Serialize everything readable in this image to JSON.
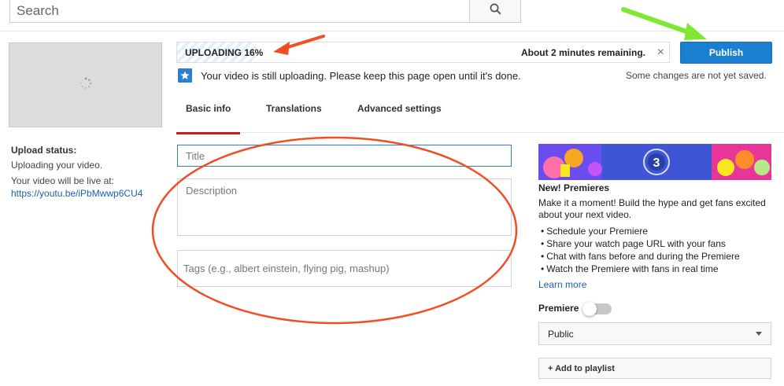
{
  "search": {
    "placeholder": "Search"
  },
  "upload_status": {
    "title": "Upload status:",
    "line1": "Uploading your video.",
    "live_label": "Your video will be live at:",
    "link": "https://youtu.be/iPbMwwp6CU4"
  },
  "progress": {
    "label": "UPLOADING 16%",
    "percent": 16,
    "remaining": "About 2 minutes remaining.",
    "close": "×"
  },
  "publish": {
    "label": "Publish",
    "note": "Some changes are not yet saved."
  },
  "notice": {
    "text": "Your video is still uploading. Please keep this page open until it's done."
  },
  "tabs": [
    {
      "label": "Basic info",
      "active": true
    },
    {
      "label": "Translations",
      "active": false
    },
    {
      "label": "Advanced settings",
      "active": false
    }
  ],
  "fields": {
    "title_placeholder": "Title",
    "description_placeholder": "Description",
    "tags_placeholder": "Tags (e.g., albert einstein, flying pig, mashup)"
  },
  "promo": {
    "banner_number": "3",
    "title": "New! Premieres",
    "desc": "Make it a moment! Build the hype and get fans excited about your next video.",
    "bullets": [
      "Schedule your Premiere",
      "Share your watch page URL with your fans",
      "Chat with fans before and during the Premiere",
      "Watch the Premiere with fans in real time"
    ],
    "learn_more": "Learn more"
  },
  "premiere": {
    "label": "Premiere",
    "enabled": false
  },
  "privacy": {
    "selected": "Public"
  },
  "playlist": {
    "label": "+ Add to playlist"
  },
  "colors": {
    "publish": "#1b7fd1",
    "tab_underline": "#cc181e",
    "link": "#1a5fb4",
    "annotation_orange": "#f04e23",
    "annotation_green": "#7ee832"
  }
}
